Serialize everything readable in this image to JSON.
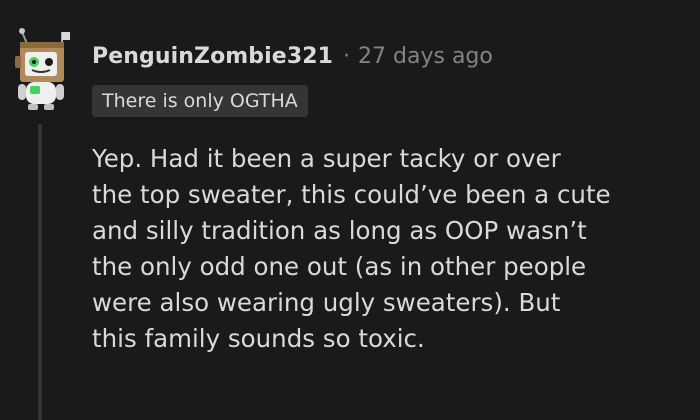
{
  "comment": {
    "author": "PenguinZombie321",
    "separator": "·",
    "timestamp": "27 days ago",
    "flair": "There is only OGTHA",
    "body_lines": [
      "Yep. Had it been a super tacky or over",
      "the top sweater, this could’ve been a cute",
      "and silly tradition as long as OOP wasn’t",
      "the only odd one out (as in other people",
      "were also wearing ugly sweaters). But",
      "this family sounds so toxic."
    ]
  },
  "colors": {
    "background": "#1a1a1b",
    "text_primary": "#d7dadc",
    "text_meta": "#818384",
    "flair_background": "#343536",
    "thread_line": "#343536"
  },
  "icons": {
    "avatar": "snoo-robot-avatar"
  }
}
